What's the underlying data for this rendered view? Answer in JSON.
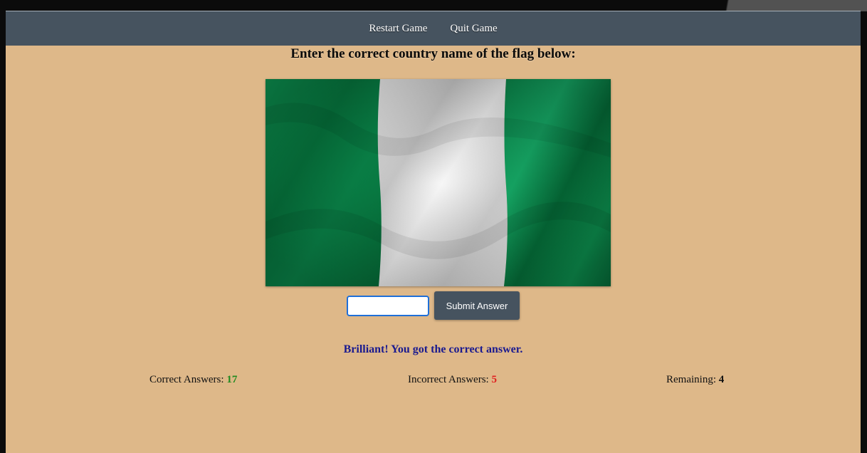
{
  "nav": {
    "restart_label": "Restart Game",
    "quit_label": "Quit Game"
  },
  "prompt": {
    "title": "Enter the correct country name of the flag below:"
  },
  "flag": {
    "icon": "nigeria-flag-icon",
    "colors": {
      "green": "#0a8a4c",
      "white": "#f2f2f2"
    }
  },
  "answer": {
    "input_value": "",
    "submit_label": "Submit Answer"
  },
  "feedback": {
    "message": "Brilliant! You got the correct answer."
  },
  "stats": {
    "correct_label": "Correct Answers:",
    "correct_value": "17",
    "incorrect_label": "Incorrect Answers:",
    "incorrect_value": "5",
    "remaining_label": "Remaining:",
    "remaining_value": "4"
  },
  "colors": {
    "background": "#deb889",
    "navbar": "#46535f",
    "feedback": "#1a1a8f",
    "correct": "#1e8a1e",
    "incorrect": "#e02020"
  }
}
